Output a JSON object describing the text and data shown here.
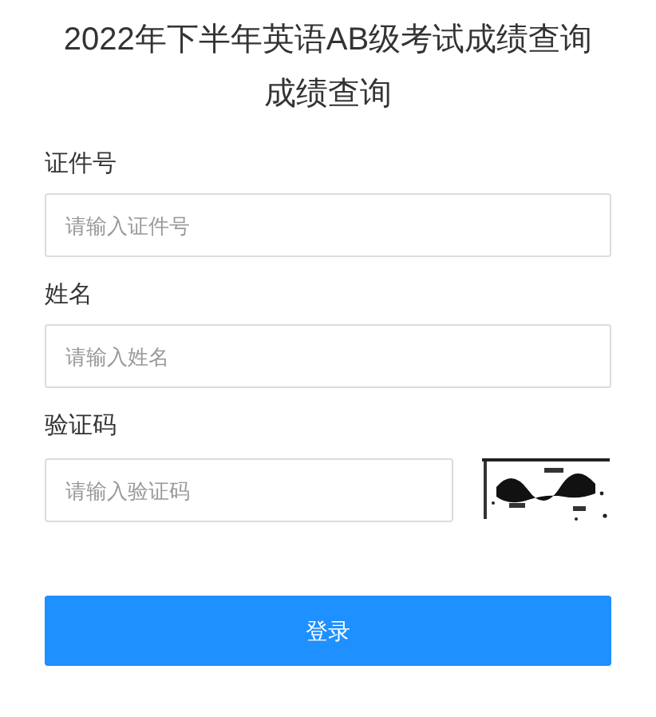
{
  "title": "2022年下半年英语AB级考试成绩查询成绩查询",
  "fields": [
    {
      "kind": "text",
      "label": "证件号",
      "placeholder": "请输入证件号"
    },
    {
      "kind": "text",
      "label": "姓名",
      "placeholder": "请输入姓名"
    },
    {
      "kind": "captcha",
      "label": "验证码",
      "placeholder": "请输入验证码"
    }
  ],
  "submit": "登录"
}
